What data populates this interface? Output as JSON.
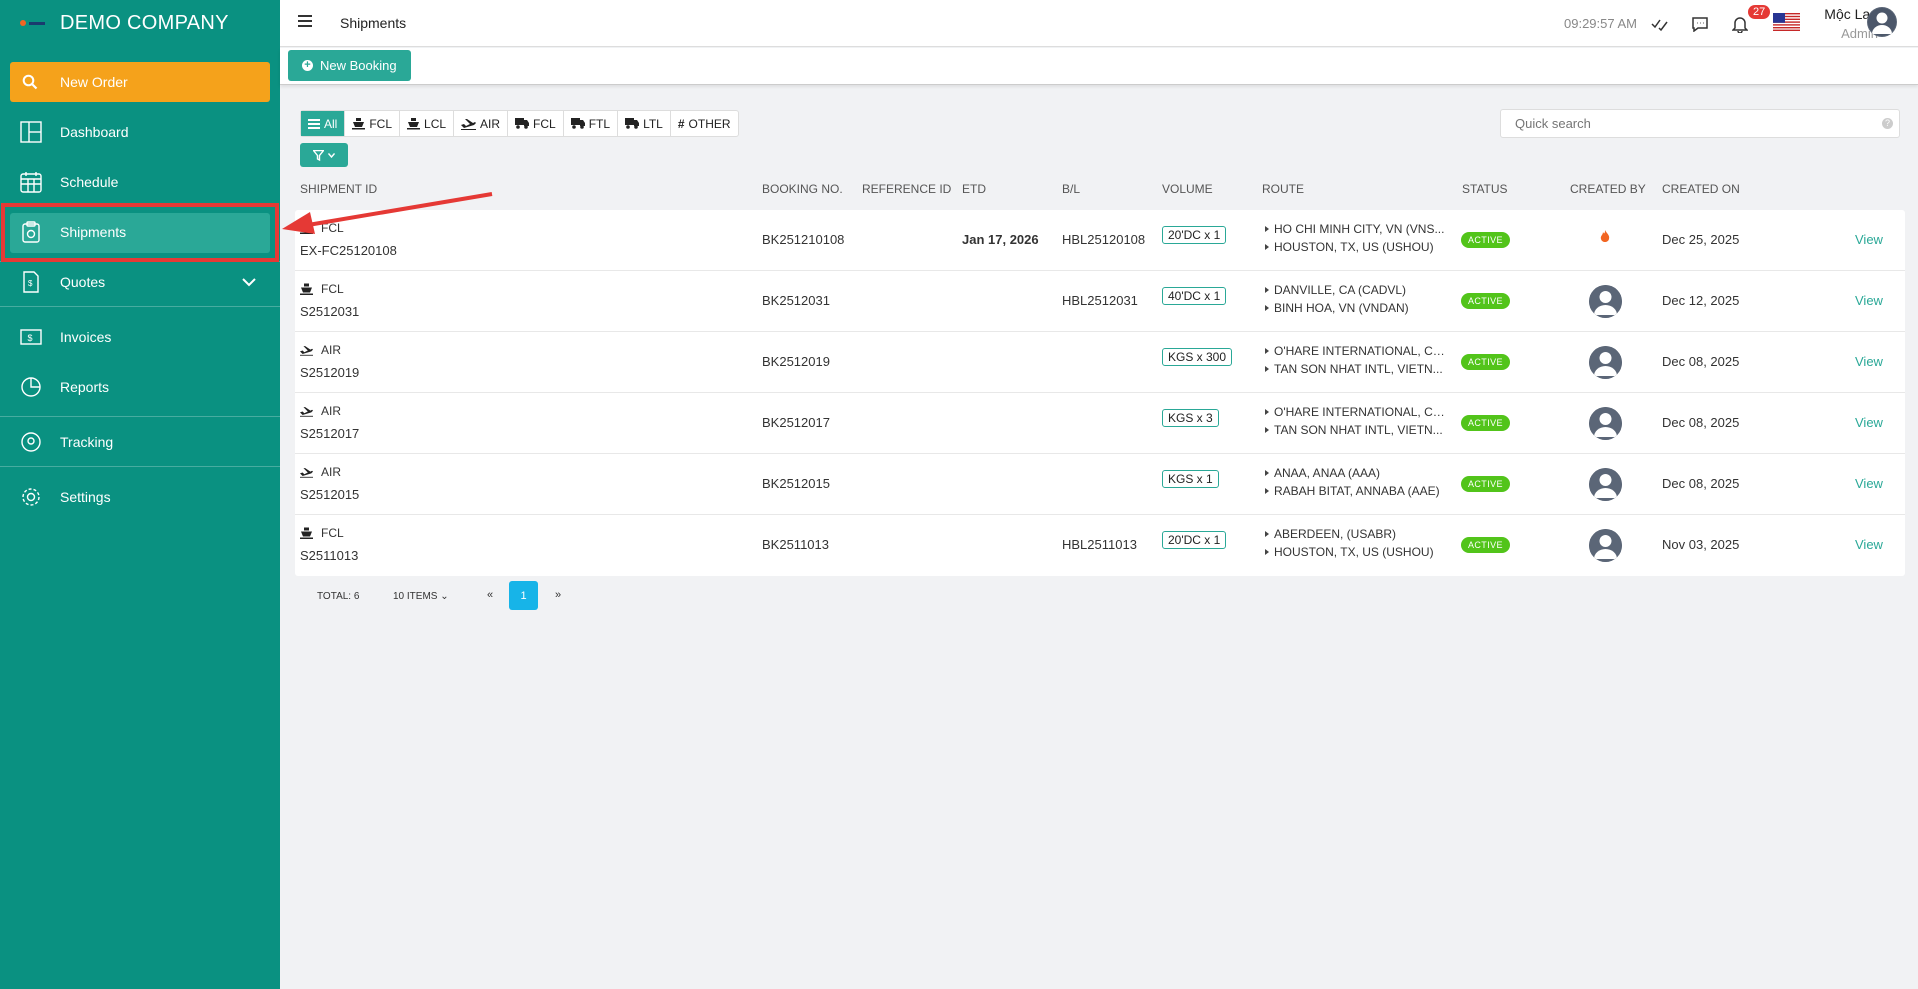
{
  "sidebar": {
    "company": "DEMO COMPANY",
    "new_order": "New Order",
    "items": [
      {
        "label": "Dashboard",
        "icon": "dashboard-icon"
      },
      {
        "label": "Schedule",
        "icon": "calendar-icon"
      },
      {
        "label": "Shipments",
        "icon": "clipboard-icon"
      },
      {
        "label": "Quotes",
        "icon": "quote-icon"
      },
      {
        "label": "Invoices",
        "icon": "invoice-icon"
      },
      {
        "label": "Reports",
        "icon": "pie-chart-icon"
      },
      {
        "label": "Tracking",
        "icon": "location-icon"
      },
      {
        "label": "Settings",
        "icon": "gear-icon"
      }
    ]
  },
  "topbar": {
    "title": "Shipments",
    "clock": "09:29:57 AM",
    "notifications": "27",
    "user_name": "Mộc Lan",
    "user_role": "Admin"
  },
  "toolbar": {
    "new_booking": "New Booking"
  },
  "filters": {
    "items": [
      "All",
      "FCL",
      "LCL",
      "AIR",
      "FCL",
      "FTL",
      "LTL",
      "OTHER"
    ],
    "active": "All"
  },
  "search": {
    "placeholder": "Quick search"
  },
  "table": {
    "headers": [
      "SHIPMENT ID",
      "BOOKING NO.",
      "REFERENCE ID",
      "ETD",
      "B/L",
      "VOLUME",
      "ROUTE",
      "STATUS",
      "CREATED BY",
      "CREATED ON"
    ],
    "rows": [
      {
        "mode": "FCL",
        "id": "EX-FC25120108",
        "booking": "BK251210108",
        "etd": "Jan 17, 2026",
        "bl": "HBL25120108",
        "volume": "20'DC x 1",
        "from": "HO CHI MINH CITY, VN (VNS...",
        "to": "HOUSTON, TX, US (USHOU)",
        "status": "ACTIVE",
        "created_on": "Dec 25, 2025",
        "action": "View"
      },
      {
        "mode": "FCL",
        "id": "S2512031",
        "booking": "BK2512031",
        "etd": "",
        "bl": "HBL2512031",
        "volume": "40'DC x 1",
        "from": "DANVILLE, CA (CADVL)",
        "to": "BINH HOA, VN (VNDAN)",
        "status": "ACTIVE",
        "created_on": "Dec 12, 2025",
        "action": "View"
      },
      {
        "mode": "AIR",
        "id": "S2512019",
        "booking": "BK2512019",
        "etd": "",
        "bl": "",
        "volume": "KGS x 300",
        "from": "O'HARE INTERNATIONAL, CH...",
        "to": "TAN SON NHAT INTL, VIETN...",
        "status": "ACTIVE",
        "created_on": "Dec 08, 2025",
        "action": "View"
      },
      {
        "mode": "AIR",
        "id": "S2512017",
        "booking": "BK2512017",
        "etd": "",
        "bl": "",
        "volume": "KGS x 3",
        "from": "O'HARE INTERNATIONAL, CH...",
        "to": "TAN SON NHAT INTL, VIETN...",
        "status": "ACTIVE",
        "created_on": "Dec 08, 2025",
        "action": "View"
      },
      {
        "mode": "AIR",
        "id": "S2512015",
        "booking": "BK2512015",
        "etd": "",
        "bl": "",
        "volume": "KGS x 1",
        "from": "ANAA, ANAA (AAA)",
        "to": "RABAH BITAT, ANNABA (AAE)",
        "status": "ACTIVE",
        "created_on": "Dec 08, 2025",
        "action": "View"
      },
      {
        "mode": "FCL",
        "id": "S2511013",
        "booking": "BK2511013",
        "etd": "",
        "bl": "HBL2511013",
        "volume": "20'DC x 1",
        "from": "ABERDEEN, (USABR)",
        "to": "HOUSTON, TX, US (USHOU)",
        "status": "ACTIVE",
        "created_on": "Nov 03, 2025",
        "action": "View"
      }
    ]
  },
  "pagination": {
    "total": "TOTAL: 6",
    "per_page": "10 ITEMS",
    "prev": "«",
    "page": "1",
    "next": "»"
  },
  "colors": {
    "sidebar": "#0a9181",
    "accent": "#2aa897",
    "new_order": "#f5a21b",
    "status_active": "#52c41a",
    "annotation": "#e53935"
  }
}
